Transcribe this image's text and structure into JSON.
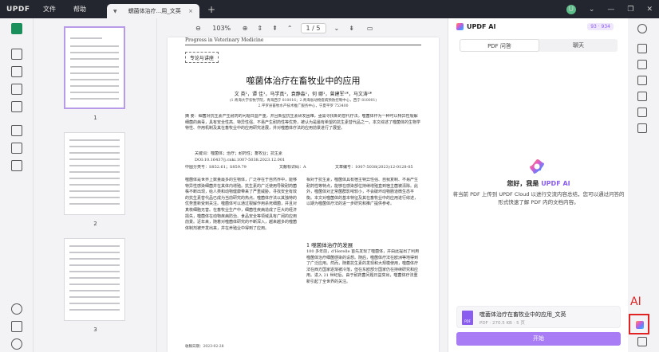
{
  "titlebar": {
    "logo": "UPDF",
    "menu": [
      "文件",
      "帮助"
    ],
    "tab_name": "蠕菌体治疗...用_文英",
    "tab_close": "×",
    "new_tab": "+",
    "avatar_letter": "U"
  },
  "doc_toolbar": {
    "zoom": "103%",
    "page_current": "1",
    "page_sep": "/",
    "page_total": "5"
  },
  "thumbnails": [
    {
      "page": "1"
    },
    {
      "page": "2"
    },
    {
      "page": "3"
    }
  ],
  "document": {
    "journal": "Progress in Veterinary Medicine",
    "column": "专论与讲座",
    "title": "噬菌体治疗在畜牧业中的应用",
    "authors": "文 英¹，谭 佳¹，马学真²，袁静淼¹，何 娜¹，曾建军¹*，马文涛¹*",
    "affiliation_1": "(1.青海大学农牧学院，青海西宁 810016；2.青海省动物疫病预防控制中心，西宁 810001)",
    "affiliation_2": "2.平罗县畜牧水产技术推广服务中心，宁夏平罗 753400",
    "abstract": "摘 要：细菌对抗生素产生耐药的问题日益严重，并且新型抗生素研发困难，亟需寻找新的替代疗法。噬菌体作为一种可以特异性裂解细菌的病毒，具有安全性高、特异性强、不易产生耐药性等优势，被认为是最有希望的抗生素替代品之一。本文综述了噬菌体的生物学特性、作用机制及其在畜牧业中的应用研究进展，并对噬菌体疗法的应用前景进行了展望。",
    "keywords": "关键词：噬菌体；治疗；耐药性；畜牧业；抗生素",
    "doi": "DOI:10.16437/j.cnki.1007-5038.2023.12.001",
    "clc": "中图分类号：S852.61；S859.79",
    "doc_code": "文献标识码：A",
    "article_no": "文章编号：1007-5038(2023)12-0128-05",
    "col1_text": "噬菌体是世界上数量最多的生物体，广泛存在于自然界中，能够特异性感染细菌并在其体内增殖。抗生素的广泛使用导致耐药菌株不断出现，给人类和动物健康带来了严重威胁。寻找安全有效的抗生素替代品已成为当前研究的热点。噬菌体疗法以其独特的优势重新受到关注。噬菌体可以通过裂解作用杀死细菌，并且对真核细胞无害。在畜牧业生产中，细菌性疾病造成了巨大的经济损失，噬菌体在动物疾病防治、食品安全等领域具有广阔的应用前景。近年来，随着对噬菌体研究的不断深入，越来越多的噬菌体制剂被开发出来，并在养殖业中得到了应用。",
    "col2_text": "相对于抗生素，噬菌体具有宿主特异性强、自我复制、不易产生耐药性等特点，能够在感染部位持续增殖直到宿主菌被清除。此外，噬菌体对正常菌群影响较小，不会破坏动物肠道微生态平衡。本文对噬菌体的基本特征及其在畜牧业中的应用进行综述，以期为噬菌体疗法的进一步研究和推广提供参考。",
    "section": "1  噬菌体治疗的发展",
    "col2_text2": "100 多年前，d'Herelle 首先发现了噬菌体，并由此提出了利用噬菌体治疗细菌感染的设想。随后，噬菌体疗法在欧洲等地得到了广泛应用。然而，随着抗生素的发现和大规模使用，噬菌体疗法在西方国家逐渐被冷落，但在东欧部分国家仍在持续研究和应用。进入 21 世纪后，由于耐药菌问题日益突出，噬菌体疗法重新引起了全世界的关注。",
    "received": "收稿日期：2023-02-28"
  },
  "ai_panel": {
    "title": "UPDF AI",
    "credits": "93 · 934",
    "tabs": [
      "PDF 问答",
      "聊天"
    ],
    "greeting_prefix": "您好，我是",
    "greeting_brand": "UPDF AI",
    "description": "将当前 PDF 上传到 UPDF Cloud 以进行交流内容总结，您可以通过问答的形式快速了解 PDF 内的文档内容。",
    "file_badge": "PDF",
    "file_name": "噬菌体治疗在畜牧业中的应用_文英",
    "file_meta": "PDF · 270.5 KB · 5 页",
    "start_button": "开始"
  },
  "annotation": {
    "label": "AI",
    "color": "#e02424"
  },
  "colors": {
    "accent": "#8a5cf0",
    "button": "#a77cf5",
    "active_tool": "#1a8f5c"
  }
}
